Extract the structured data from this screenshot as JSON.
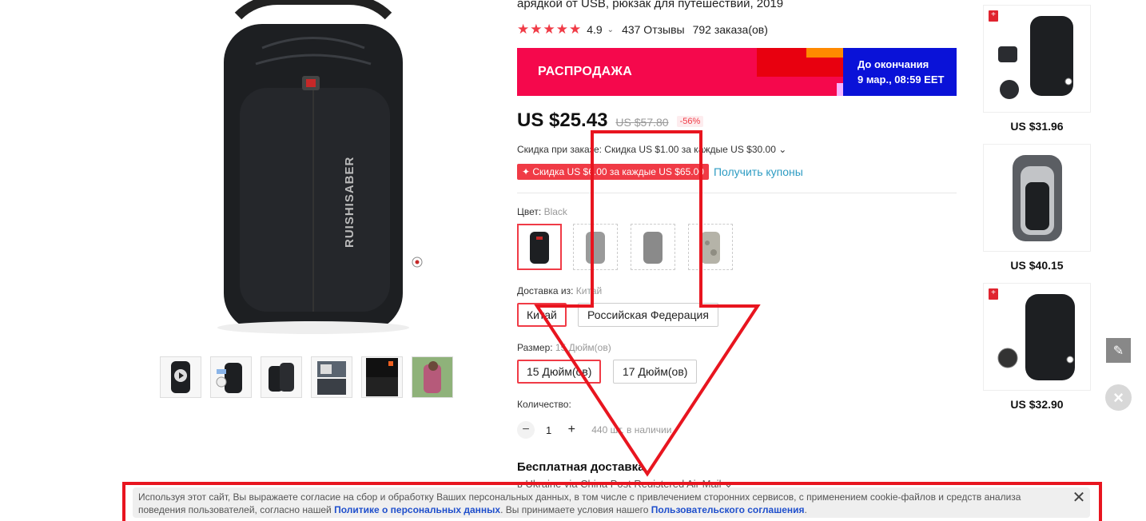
{
  "product": {
    "title": "арядкой от USB, рюкзак для путешествий, 2019",
    "rating": "4.9",
    "reviews": "437 Отзывы",
    "orders": "792 заказа(ов)",
    "stars": "★★★★★"
  },
  "sale": {
    "label": "РАСПРОДАЖА",
    "timer_line1": "До окончания",
    "timer_line2": "9 мар., 08:59 EET"
  },
  "price": {
    "current": "US $25.43",
    "old": "US $57.80",
    "discount": "-56%"
  },
  "order_discount": "Скидка при заказе: Скидка US $1.00 за каждые US $30.00 ⌄",
  "coupon": {
    "badge": "✦ Скидка US $6.00 за каждые US $65.00",
    "link": "Получить купоны"
  },
  "color": {
    "label": "Цвет:",
    "value": "Black"
  },
  "shipping_from": {
    "label": "Доставка из:",
    "value": "Китай",
    "options": [
      "Китай",
      "Российская Федерация"
    ]
  },
  "size": {
    "label": "Размер:",
    "value": "15 Дюйм(ов)",
    "options": [
      "15 Дюйм(ов)",
      "17 Дюйм(ов)"
    ]
  },
  "quantity": {
    "label": "Количество:",
    "value": "1",
    "minus": "−",
    "plus": "+",
    "stock": "440 шт. в наличии"
  },
  "free_shipping": "Бесплатная доставка",
  "shipping_peek": "в Ukraine via China Post Registered Air Mail ⌄",
  "recommendations": [
    {
      "price": "US $31.96"
    },
    {
      "price": "US $40.15"
    },
    {
      "price": "US $32.90"
    }
  ],
  "cookie": {
    "text1": "Используя этот сайт, Вы выражаете согласие на сбор и обработку Ваших персональных данных, в том числе с привлечением сторонних сервисов, с применением cookie-файлов и средств анализа поведения пользователей, согласно нашей ",
    "link1": "Политике о персональных данных",
    "text2": ". Вы принимаете условия нашего ",
    "link2": "Пользовательского соглашения",
    "text3": ".",
    "close": "✕"
  },
  "icons": {
    "edit": "pencil-icon",
    "close": "close-icon"
  },
  "colors": {
    "accent_red": "#f03b46",
    "sale_pink": "#f5084c",
    "timer_blue": "#0a12d8",
    "annotation_red": "#e8151f"
  }
}
